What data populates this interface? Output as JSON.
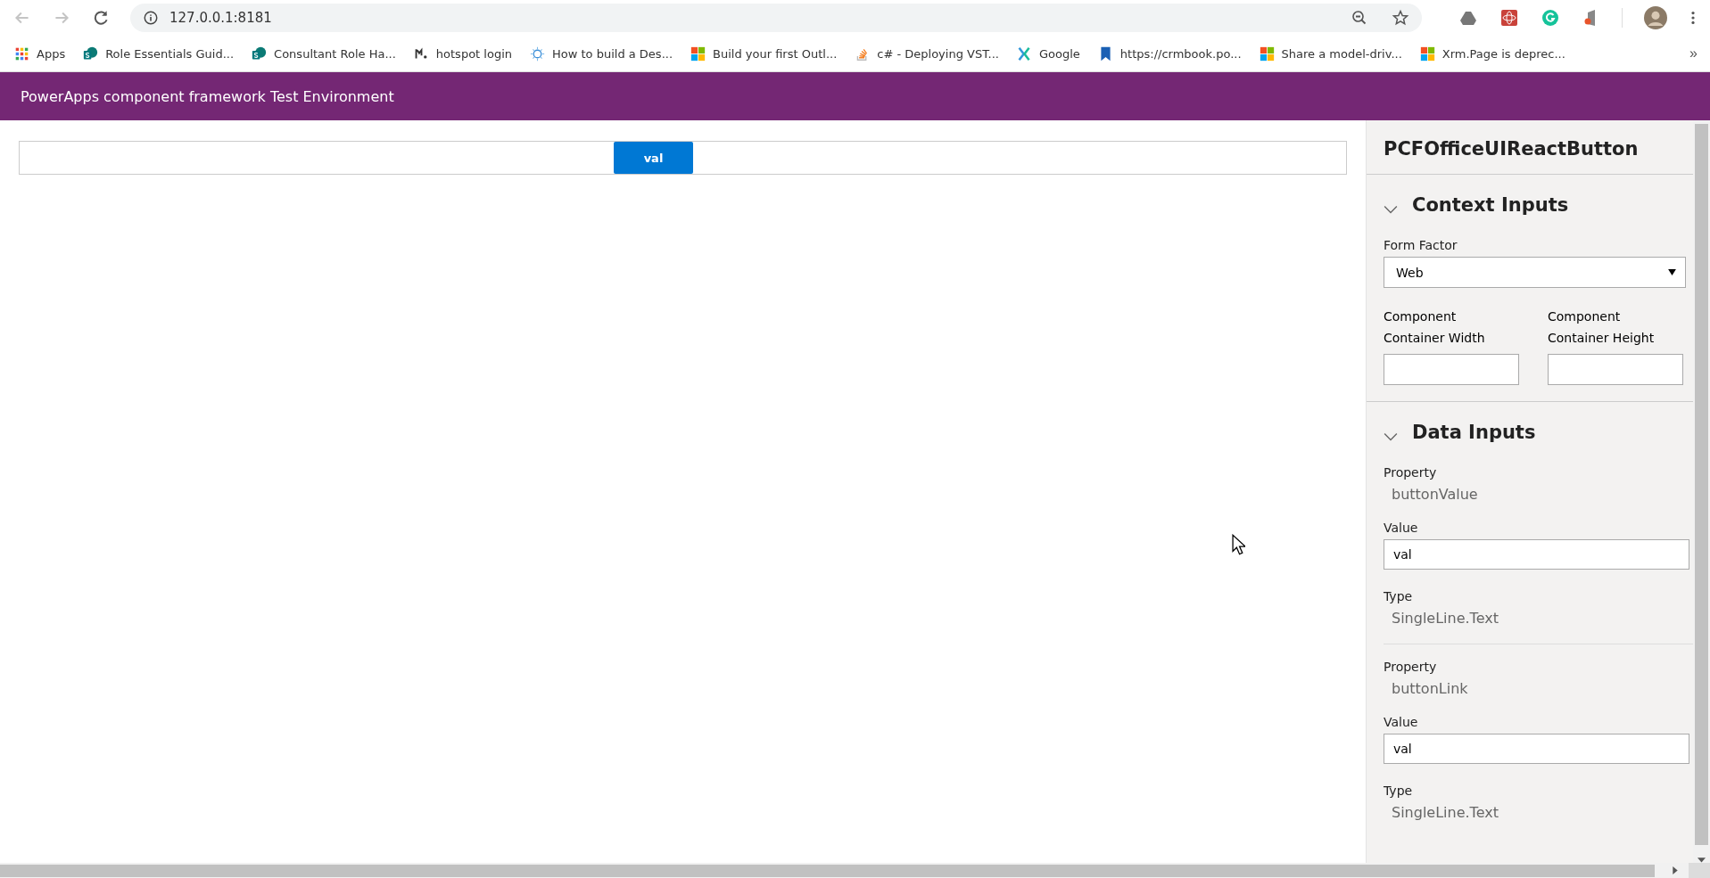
{
  "browser": {
    "back_disabled": true,
    "forward_disabled": true,
    "address": "127.0.0.1:8181",
    "bookmarks": [
      {
        "label": "Apps"
      },
      {
        "label": "Role Essentials Guid..."
      },
      {
        "label": "Consultant Role Ha..."
      },
      {
        "label": "hotspot login"
      },
      {
        "label": "How to build a Des..."
      },
      {
        "label": "Build your first Outl..."
      },
      {
        "label": "c# - Deploying VST..."
      },
      {
        "label": "Google"
      },
      {
        "label": "https://crmbook.po..."
      },
      {
        "label": "Share a model-driv..."
      },
      {
        "label": "Xrm.Page is deprec..."
      }
    ],
    "more": "»"
  },
  "header": {
    "title": "PowerApps component framework Test Environment"
  },
  "control": {
    "button_label": "val"
  },
  "panel": {
    "title": "PCFOfficeUIReactButton",
    "context": {
      "heading": "Context Inputs",
      "expanded": true,
      "form_factor_label": "Form Factor",
      "form_factor": "Web",
      "width_label": "Component Container Width",
      "height_label": "Component Container Height"
    },
    "data": {
      "heading": "Data Inputs",
      "expanded": true,
      "properties": [
        {
          "property_label": "Property",
          "name": "buttonValue",
          "value_label": "Value",
          "value": "val",
          "type_label": "Type",
          "type": "SingleLine.Text"
        },
        {
          "property_label": "Property",
          "name": "buttonLink",
          "value_label": "Value",
          "value": "val",
          "type_label": "Type",
          "type": "SingleLine.Text"
        }
      ]
    }
  }
}
